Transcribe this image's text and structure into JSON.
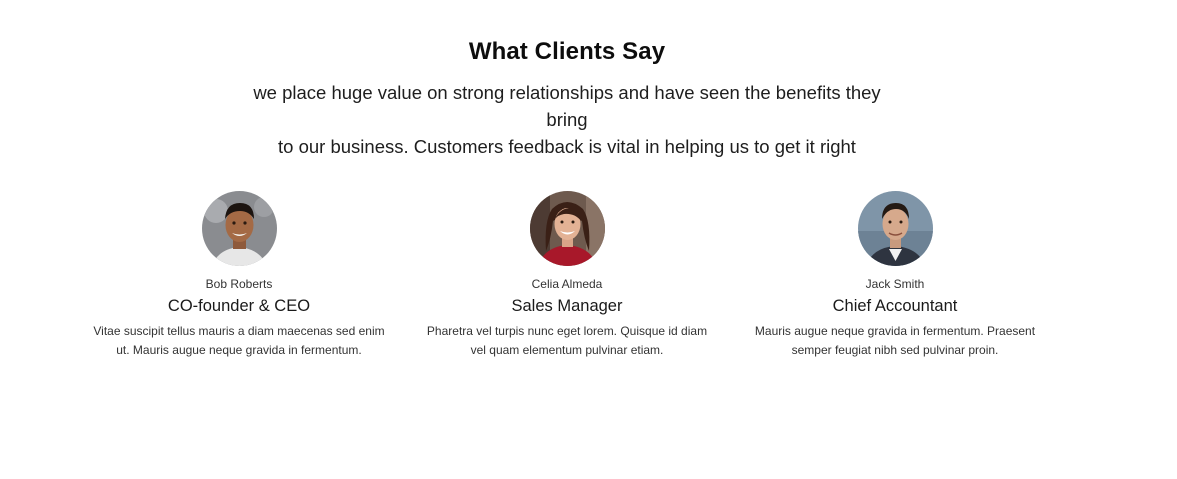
{
  "section": {
    "title": "What Clients Say",
    "subtitle_line1": "we place huge value on strong relationships and have seen the benefits they bring",
    "subtitle_line2": "to our business. Customers feedback is vital in helping us to get it right"
  },
  "testimonials": [
    {
      "name": "Bob Roberts",
      "role": "CO-founder & CEO",
      "quote_line1": "Vitae suscipit tellus mauris a diam maecenas sed enim",
      "quote_line2": "ut. Mauris augue neque gravida in fermentum.",
      "avatar_icon": "man-portrait-photo"
    },
    {
      "name": "Celia Almeda",
      "role": "Sales Manager",
      "quote_line1": "Pharetra vel turpis nunc eget lorem. Quisque id diam",
      "quote_line2": "vel quam elementum pulvinar etiam.",
      "avatar_icon": "woman-portrait-photo"
    },
    {
      "name": "Jack Smith",
      "role": "Chief Accountant",
      "quote_line1": "Mauris augue neque gravida in fermentum. Praesent",
      "quote_line2": "semper feugiat nibh sed pulvinar proin.",
      "avatar_icon": "man-portrait-photo"
    }
  ]
}
